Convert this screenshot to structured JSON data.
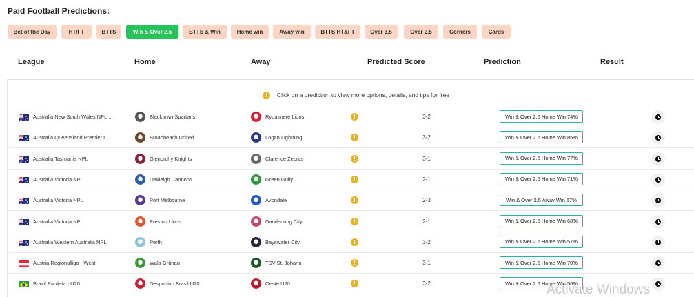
{
  "page": {
    "title": "Paid Football Predictions:"
  },
  "categories": [
    {
      "label": "Bet of the Day"
    },
    {
      "label": "HT/FT"
    },
    {
      "label": "BTTS"
    },
    {
      "label": "Win & Over 2.5",
      "active": true
    },
    {
      "label": "BTTS & Win"
    },
    {
      "label": "Home win"
    },
    {
      "label": "Away win"
    },
    {
      "label": "BTTS HT&FT"
    },
    {
      "label": "Over 3.5"
    },
    {
      "label": "Over 2.5"
    },
    {
      "label": "Corners"
    },
    {
      "label": "Cards"
    }
  ],
  "columns": {
    "league": "League",
    "home": "Home",
    "away": "Away",
    "predicted_score": "Predicted Score",
    "prediction": "Prediction",
    "result": "Result"
  },
  "info": {
    "text": "Click on a prediction to view more options, details, and tips for free"
  },
  "rows": [
    {
      "league": "Australia New South Wales NPL...",
      "flag": "australia",
      "home": "Blacktown Spartans",
      "away": "Rydalmere Lions",
      "score": "3-2",
      "prediction": "Win & Over 2.5 Home Win 74%"
    },
    {
      "league": "Australia Queensland Premier L...",
      "flag": "australia",
      "home": "Broadbeach United",
      "away": "Logan Lightning",
      "score": "3-2",
      "prediction": "Win & Over 2.5 Home Win 85%"
    },
    {
      "league": "Australia Tasmania NPL",
      "flag": "australia",
      "home": "Glenorchy Knights",
      "away": "Clarence Zebras",
      "score": "3-1",
      "prediction": "Win & Over 2.5 Home Win 77%"
    },
    {
      "league": "Australia Victoria NPL",
      "flag": "australia",
      "home": "Oakleigh Cannons",
      "away": "Green Gully",
      "score": "2-1",
      "prediction": "Win & Over 2.5 Home Win 71%"
    },
    {
      "league": "Australia Victoria NPL",
      "flag": "australia",
      "home": "Port Melbourne",
      "away": "Avondale",
      "score": "2-3",
      "prediction": "Win & Over 2.5 Away Win 57%"
    },
    {
      "league": "Australia Victoria NPL",
      "flag": "australia",
      "home": "Preston Lions",
      "away": "Dandenong City",
      "score": "2-1",
      "prediction": "Win & Over 2.5 Home Win 68%"
    },
    {
      "league": "Australia Western Australia NPL",
      "flag": "australia",
      "home": "Perth",
      "away": "Bayswater City",
      "score": "3-2",
      "prediction": "Win & Over 2.5 Home Win 57%"
    },
    {
      "league": "Austria Regionalliga - West",
      "flag": "austria",
      "home": "Wals-Grünau",
      "away": "TSV St. Johann",
      "score": "3-1",
      "prediction": "Win & Over 2.5 Home Win 70%"
    },
    {
      "league": "Brazil Paulista - U20",
      "flag": "brazil",
      "home": "Desportivo Brasil U20",
      "away": "Oeste U20",
      "score": "3-2",
      "prediction": "Win & Over 2.5 Home Win 56%"
    }
  ],
  "team_logo_colors": {
    "home": [
      "#555555",
      "#6b4a2a",
      "#8a1f3a",
      "#2b5fa8",
      "#5a3a8a",
      "#e5542a",
      "#8ec4d6",
      "#3a9a3a",
      "#c9243a"
    ],
    "away": [
      "#d0243a",
      "#2a3a8a",
      "#6a6a6a",
      "#2e9a3a",
      "#2a5ac4",
      "#c4486a",
      "#2a2a3a",
      "#1f5a2a",
      "#b81f2a"
    ]
  },
  "watermark": {
    "text": "Activate Windows"
  }
}
